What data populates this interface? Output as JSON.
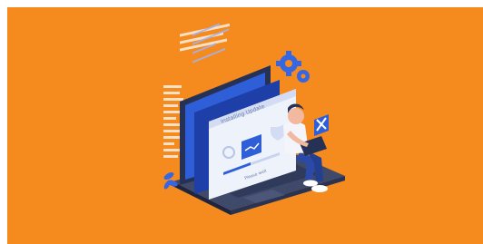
{
  "colors": {
    "background": "#f58a1f",
    "frame": "#ffffff",
    "laptop_dark": "#263255",
    "laptop_base": "#3f4a6b",
    "accent_blue": "#2f5fd8",
    "window_light": "#eef2fb",
    "gear_blue": "#3567e3",
    "person_shirt": "#f3f5fa",
    "person_pants": "#2b4aa8",
    "code_stripes": "#ffffff"
  },
  "illustration": {
    "subject": "person-with-laptop-software-installation",
    "window_title": "Installing Update",
    "window_caption": "Please wait"
  },
  "icons": [
    "gear-icon",
    "wrench-screwdriver-icon",
    "shield-icon",
    "settings-cog-icon"
  ]
}
